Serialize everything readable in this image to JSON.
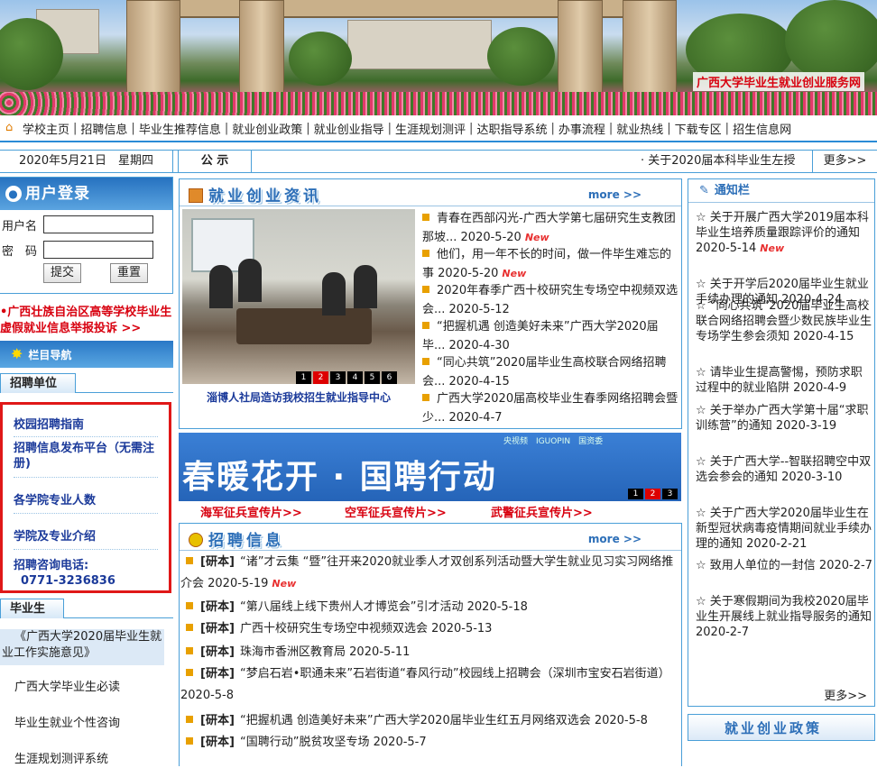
{
  "banner": {
    "title": "广西大学毕业生就业创业服务网"
  },
  "nav": {
    "items": [
      "学校主页",
      "招聘信息",
      "毕业生推荐信息",
      "就业创业政策",
      "就业创业指导",
      "生涯规划测评",
      "达职指导系统",
      "办事流程",
      "就业热线",
      "下载专区",
      "招生信息网"
    ]
  },
  "datebar": {
    "date": "2020年5月21日　星期四",
    "label": "公 示",
    "marquee": "· 关于2020届本科毕业生左授",
    "more": "更多>>"
  },
  "login": {
    "title": "用户登录",
    "username_label": "用户名",
    "password_label": "密　码",
    "submit": "提交",
    "reset": "重置"
  },
  "report": {
    "line1": "•广西壮族自治区高等学校毕业生",
    "line2": "虚假就业信息举报投诉 >>"
  },
  "column_nav": {
    "title": "栏目导航",
    "employer_tab": "招聘单位",
    "employer_items": [
      "校园招聘指南",
      "招聘信息发布平台（无需注册)",
      "各学院专业人数",
      "学院及专业介绍",
      "招聘咨询电话:",
      "0771-3236836"
    ],
    "graduate_tab": "毕业生",
    "graduate_items": [
      "《广西大学2020届毕业生就业工作实施意见》",
      "广西大学毕业生必读",
      "毕业生就业个性咨询",
      "生涯规划测评系统"
    ]
  },
  "news": {
    "title": "就业创业资讯",
    "more": "more >>",
    "caption": "淄博人社局造访我校招生就业指导中心",
    "pager": [
      "1",
      "2",
      "3",
      "4",
      "5",
      "6"
    ],
    "pager_active": "2",
    "items": [
      {
        "text": "青春在西部闪光-广西大学第七届研究生支教团那坡... 2020-5-20",
        "new": "New"
      },
      {
        "text": "他们，用一年不长的时间，做一件毕生难忘的事 2020-5-20",
        "new": "New"
      },
      {
        "text": "2020年春季广西十校研究生专场空中视频双选会... 2020-5-12",
        "new": ""
      },
      {
        "text": "“把握机遇 创造美好未来”广西大学2020届毕... 2020-4-30",
        "new": ""
      },
      {
        "text": "“同心共筑”2020届毕业生高校联合网络招聘会... 2020-4-15",
        "new": ""
      },
      {
        "text": "广西大学2020届高校毕业生春季网络招聘会暨少... 2020-4-7",
        "new": ""
      }
    ]
  },
  "promo": {
    "slogan": "春暖花开 · 国聘行动",
    "logos": "央视频　IGUOPIN　国资委",
    "pager": [
      "1",
      "2",
      "3"
    ],
    "pager_active": "2",
    "links": [
      "海军征兵宣传片>>",
      "空军征兵宣传片>>",
      "武警征兵宣传片>>"
    ]
  },
  "recruit": {
    "title": "招聘信息",
    "more": "more >>",
    "items": [
      {
        "tag": "[研本]",
        "text": "“诸”才云集 “暨”往开来2020就业季人才双创系列活动暨大学生就业见习实习网络推介会 2020-5-19",
        "new": "New"
      },
      {
        "tag": "[研本]",
        "text": "“第八届线上线下贵州人才博览会”引才活动 2020-5-18",
        "new": ""
      },
      {
        "tag": "[研本]",
        "text": "广西十校研究生专场空中视频双选会 2020-5-13",
        "new": ""
      },
      {
        "tag": "[研本]",
        "text": "珠海市香洲区教育局 2020-5-11",
        "new": ""
      },
      {
        "tag": "[研本]",
        "text": "“梦启石岩•职通未来”石岩街道“春风行动”校园线上招聘会（深圳市宝安石岩街道） 2020-5-8",
        "new": ""
      },
      {
        "tag": "[研本]",
        "text": "“把握机遇 创造美好未来”广西大学2020届毕业生红五月网络双选会 2020-5-8",
        "new": ""
      },
      {
        "tag": "[研本]",
        "text": "“国聘行动”脱贫攻坚专场 2020-5-7",
        "new": ""
      }
    ]
  },
  "notice": {
    "title": "通知栏",
    "more": "更多>>",
    "items": [
      {
        "text": "☆ 关于开展广西大学2019届本科毕业生培养质量跟踪评价的通知 2020-5-14",
        "new": "New"
      },
      {
        "text": "☆ 关于开学后2020届毕业生就业手续办理的通知 2020-4-24",
        "new": ""
      },
      {
        "text": "☆ “同心共筑”2020届毕业生高校联合网络招聘会暨少数民族毕业生专场学生参会须知 2020-4-15",
        "new": ""
      },
      {
        "text": "☆ 请毕业生提高警惕，预防求职过程中的就业陷阱 2020-4-9",
        "new": ""
      },
      {
        "text": "☆ 关于举办广西大学第十届“求职训练营”的通知 2020-3-19",
        "new": ""
      },
      {
        "text": "☆ 关于广西大学--智联招聘空中双选会参会的通知 2020-3-10",
        "new": ""
      },
      {
        "text": "☆ 关于广西大学2020届毕业生在新型冠状病毒疫情期间就业手续办理的通知 2020-2-21",
        "new": ""
      },
      {
        "text": "☆ 致用人单位的一封信 2020-2-7",
        "new": ""
      },
      {
        "text": "☆ 关于寒假期间为我校2020届毕业生开展线上就业指导服务的通知 2020-2-7",
        "new": ""
      }
    ]
  },
  "policy": {
    "title": "就业创业政策"
  }
}
